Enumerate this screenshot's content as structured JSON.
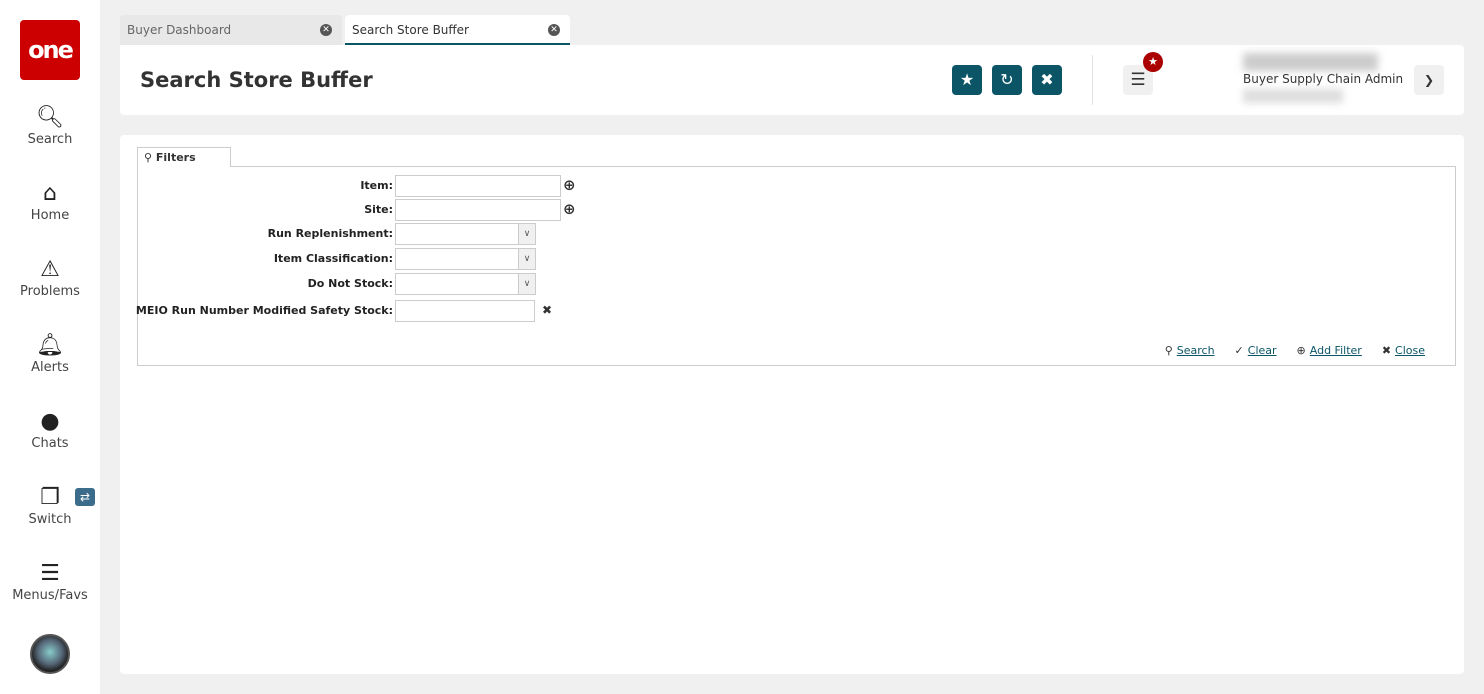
{
  "sidebar": {
    "logo": "one",
    "items": [
      {
        "label": "Search",
        "icon": "search-icon"
      },
      {
        "label": "Home",
        "icon": "home-icon"
      },
      {
        "label": "Problems",
        "icon": "warning-icon"
      },
      {
        "label": "Alerts",
        "icon": "bell-icon"
      },
      {
        "label": "Chats",
        "icon": "chat-icon"
      },
      {
        "label": "Switch",
        "icon": "switch-icon"
      },
      {
        "label": "Menus/Favs",
        "icon": "menu-icon"
      }
    ]
  },
  "tabs": [
    {
      "label": "Buyer Dashboard",
      "active": false
    },
    {
      "label": "Search Store Buffer",
      "active": true
    }
  ],
  "header": {
    "title": "Search Store Buffer",
    "role": "Buyer Supply Chain Admin"
  },
  "filters": {
    "tab_label": "Filters",
    "fields": [
      {
        "label": "Item:",
        "type": "lookup",
        "value": ""
      },
      {
        "label": "Site:",
        "type": "lookup",
        "value": ""
      },
      {
        "label": "Run Replenishment:",
        "type": "select",
        "value": ""
      },
      {
        "label": "Item Classification:",
        "type": "select",
        "value": ""
      },
      {
        "label": "Do Not Stock:",
        "type": "select",
        "value": ""
      },
      {
        "label": "MEIO Run Number Modified Safety Stock:",
        "type": "text",
        "value": ""
      }
    ],
    "actions": {
      "search": "Search",
      "clear": "Clear",
      "add_filter": "Add Filter",
      "close": "Close"
    }
  },
  "colors": {
    "primary": "#0b5566",
    "logo": "#cc0000",
    "badge": "#aa0000"
  }
}
